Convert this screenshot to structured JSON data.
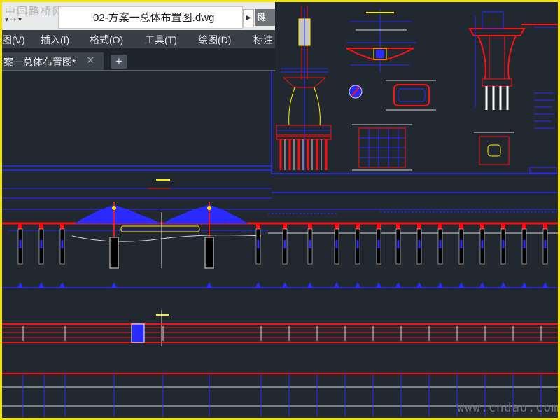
{
  "watermark": {
    "top_left": "中国路桥网",
    "site": "www.cndao.com"
  },
  "window": {
    "title": "02-方案一总体布置图.dwg",
    "search_label": "键"
  },
  "menubar": {
    "items": [
      "图(V)",
      "插入(I)",
      "格式(O)",
      "工具(T)",
      "绘图(D)",
      "标注"
    ]
  },
  "tabs": {
    "active_label": "案一总体布置图*",
    "close_glyph": "✕",
    "new_tab_glyph": "+"
  },
  "colors": {
    "background": "#212830",
    "frame": "#f2e400",
    "line_red": "#ff1010",
    "line_blue": "#2b2bff",
    "line_white": "#d8d8d8",
    "line_yellow": "#ffee00",
    "pile_fill": "#000000"
  }
}
